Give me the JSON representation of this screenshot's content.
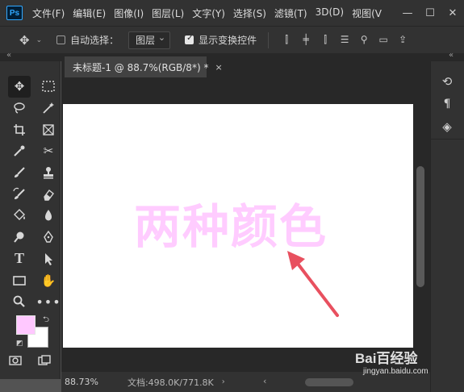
{
  "app": {
    "logo_text": "Ps"
  },
  "menu": [
    "文件(F)",
    "编辑(E)",
    "图像(I)",
    "图层(L)",
    "文字(Y)",
    "选择(S)",
    "滤镜(T)",
    "3D(D)",
    "视图(V"
  ],
  "window_controls": [
    "—",
    "☐",
    "✕"
  ],
  "options_bar": {
    "auto_select_label": "自动选择：",
    "auto_select_checked": false,
    "layer_select_value": "图层",
    "show_transform_label": "显示变换控件",
    "show_transform_checked": true
  },
  "document": {
    "tab_title": "未标题-1 @ 88.7%(RGB/8*) *",
    "close_glyph": "×",
    "canvas_text": "两种颜色",
    "canvas_text_color": "#ffccff"
  },
  "tools": {
    "foreground_color": "#ffc8ff",
    "background_color": "#ffffff"
  },
  "status": {
    "zoom": "88.73%",
    "doc_info": "文档:498.0K/771.8K"
  },
  "watermark": {
    "main": "Bai百经验",
    "sub": "jingyan.baidu.com"
  }
}
